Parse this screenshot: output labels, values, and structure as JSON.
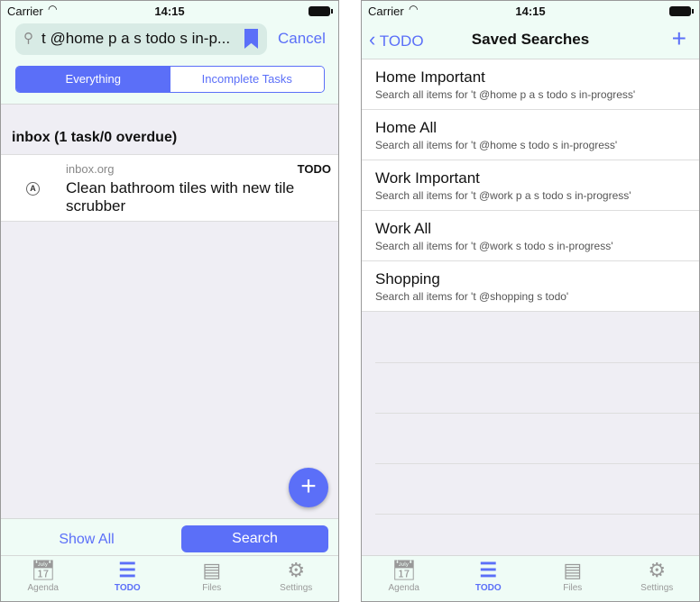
{
  "status": {
    "carrier": "Carrier",
    "time": "14:15"
  },
  "left": {
    "search_query": "t @home p a s todo s in-p...",
    "cancel": "Cancel",
    "segments": [
      "Everything",
      "Incomplete Tasks"
    ],
    "selected_segment": "Everything",
    "section_header": "inbox (1 task/0 overdue)",
    "task": {
      "priority": "A",
      "file": "inbox.org",
      "keyword": "TODO",
      "title": "Clean bathroom tiles with new tile scrubber"
    },
    "fab": "+",
    "show_all": "Show All",
    "search_button": "Search"
  },
  "right": {
    "back": "TODO",
    "title": "Saved Searches",
    "add": "+",
    "items": [
      {
        "name": "Home Important",
        "desc": "Search all items for 't @home p a s todo s in-progress'"
      },
      {
        "name": "Home All",
        "desc": "Search all items for 't @home s todo s in-progress'"
      },
      {
        "name": "Work Important",
        "desc": "Search all items for 't @work p a s todo s in-progress'"
      },
      {
        "name": "Work All",
        "desc": "Search all items for 't @work s todo s in-progress'"
      },
      {
        "name": "Shopping",
        "desc": "Search all items for 't @shopping s todo'"
      }
    ]
  },
  "tabs": [
    {
      "label": "Agenda",
      "icon": "calendar-icon"
    },
    {
      "label": "TODO",
      "icon": "checklist-icon"
    },
    {
      "label": "Files",
      "icon": "cabinet-icon"
    },
    {
      "label": "Settings",
      "icon": "gear-icon"
    }
  ],
  "active_tab": "TODO",
  "colors": {
    "accent": "#5b6ff8",
    "bar": "#effcf6"
  }
}
